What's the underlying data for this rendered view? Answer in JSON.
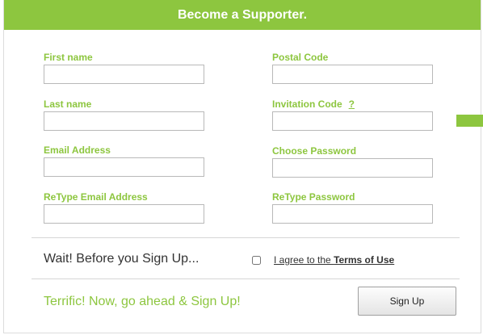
{
  "header": {
    "title": "Become a Supporter."
  },
  "form": {
    "first_name": {
      "label": "First name",
      "value": ""
    },
    "last_name": {
      "label": "Last name",
      "value": ""
    },
    "email": {
      "label": "Email Address",
      "value": ""
    },
    "retype_email": {
      "label": "ReType Email Address",
      "value": ""
    },
    "postal_code": {
      "label": "Postal Code",
      "value": ""
    },
    "invitation_code": {
      "label": "Invitation Code",
      "help": "?",
      "value": ""
    },
    "password": {
      "label": "Choose Password",
      "value": ""
    },
    "retype_password": {
      "label": "ReType Password",
      "value": ""
    }
  },
  "terms": {
    "prompt": "Wait! Before you Sign Up...",
    "agree_prefix": "I agree to the ",
    "agree_link": "Terms of Use",
    "checked": false
  },
  "footer": {
    "message": "Terrific! Now, go ahead & Sign Up!",
    "signup_label": "Sign Up"
  },
  "colors": {
    "accent": "#8dc63f",
    "text": "#333333",
    "border": "#b9b9b9"
  }
}
